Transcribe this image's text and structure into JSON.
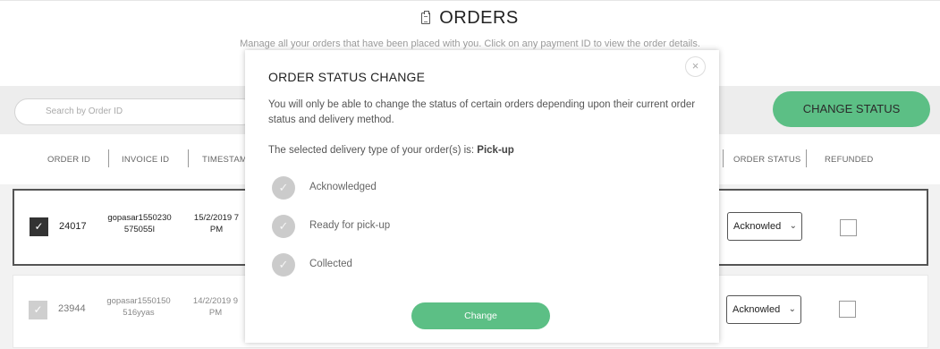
{
  "page": {
    "title": "ORDERS",
    "subtitle": "Manage all your orders that have been placed with you. Click on any payment ID to view the order details.",
    "title_icon": "clipboard-icon"
  },
  "toolbar": {
    "search_placeholder": "Search by Order ID",
    "change_status_label": "CHANGE STATUS",
    "accent_color": "#5cbf85"
  },
  "table": {
    "columns": [
      "ORDER ID",
      "INVOICE ID",
      "TIMESTAMP",
      "ORDER STATUS",
      "REFUNDED"
    ],
    "rows": [
      {
        "order_id": "24017",
        "invoice_line1": "gopasar1550230",
        "invoice_line2": "575055I",
        "ts_line1": "15/2/2019 7",
        "ts_line2": "PM",
        "status": "Acknowled",
        "selected": true,
        "refunded": false
      },
      {
        "order_id": "23944",
        "invoice_line1": "gopasar1550150",
        "invoice_line2": "516yyas",
        "ts_line1": "14/2/2019 9",
        "ts_line2": "PM",
        "status": "Acknowled",
        "selected": false,
        "refunded": false
      }
    ]
  },
  "modal": {
    "title": "ORDER STATUS CHANGE",
    "description": "You will only be able to change the status of certain orders depending upon their current order status and delivery method.",
    "delivery_prefix": "The selected delivery type of your order(s) is: ",
    "delivery_type": "Pick-up",
    "options": [
      "Acknowledged",
      "Ready for pick-up",
      "Collected"
    ],
    "button_label": "Change",
    "close_icon": "close-icon"
  }
}
